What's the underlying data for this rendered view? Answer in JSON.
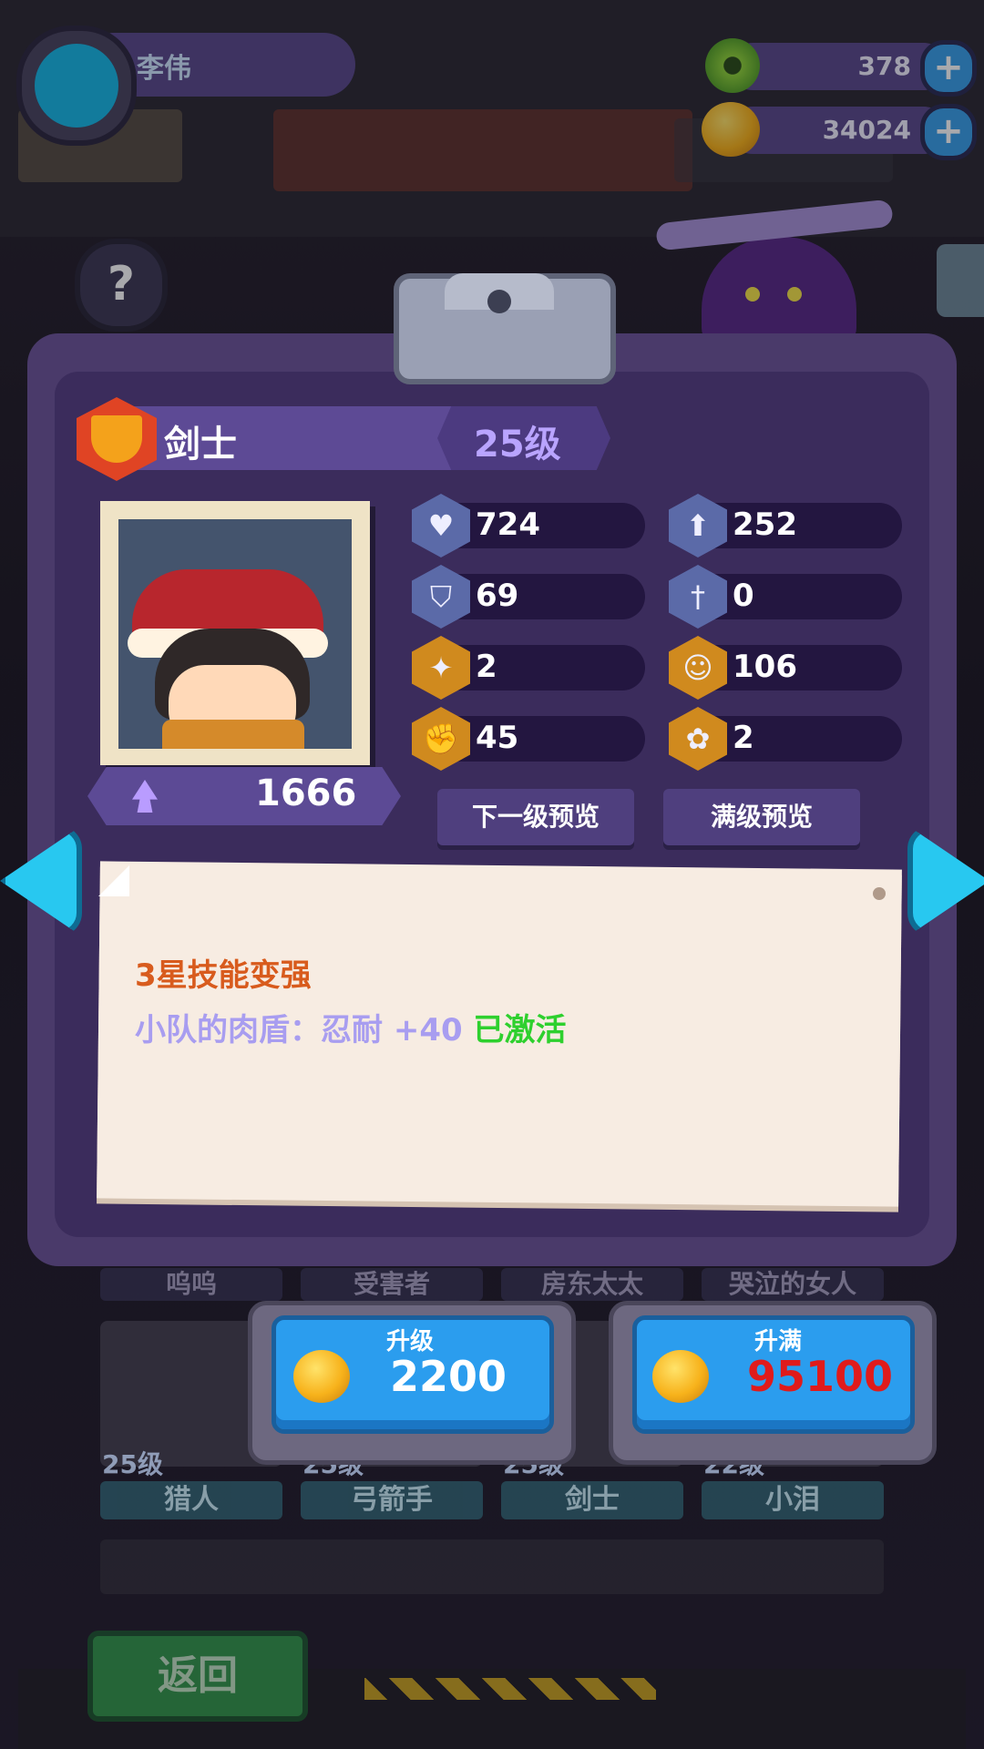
{
  "header": {
    "player_name": "李伟",
    "currencies": [
      {
        "icon": "green-ring-icon",
        "value": "378"
      },
      {
        "icon": "gold-coin-icon",
        "value": "34024"
      }
    ]
  },
  "hero": {
    "class_name": "剑士",
    "level": "25级",
    "power": "1666",
    "stats": [
      {
        "icon": "heart-icon",
        "value": "724"
      },
      {
        "icon": "attack-arrow-icon",
        "value": "252"
      },
      {
        "icon": "shield-icon",
        "value": "69"
      },
      {
        "icon": "sword-icon",
        "value": "0"
      },
      {
        "icon": "boot-icon",
        "value": "2"
      },
      {
        "icon": "smile-icon",
        "value": "106"
      },
      {
        "icon": "muscle-icon",
        "value": "45"
      },
      {
        "icon": "brain-icon",
        "value": "2"
      }
    ],
    "next_level_preview": "下一级预览",
    "max_level_preview": "满级预览"
  },
  "skill_note": {
    "title": "3星技能变强",
    "skill_name": "小队的肉盾：忍耐 +40",
    "status": "已激活"
  },
  "upgrade": {
    "upgrade_label": "升级",
    "upgrade_cost": "2200",
    "max_label": "升满",
    "max_cost": "95100"
  },
  "roster": {
    "top_tabs": [
      "呜呜",
      "受害者",
      "房东太太",
      "哭泣的女人"
    ],
    "level_tags": [
      "25级",
      "25级",
      "25级",
      "22级"
    ],
    "bottom_tabs": [
      "猎人",
      "弓箭手",
      "剑士",
      "小泪"
    ]
  },
  "back_button": "返回",
  "colors": {
    "panel": "#4a3a6a",
    "accent_blue": "#2b9dee",
    "cost_red": "#e01b1b",
    "active_green": "#2ed02e",
    "note_title": "#d85b1d"
  }
}
